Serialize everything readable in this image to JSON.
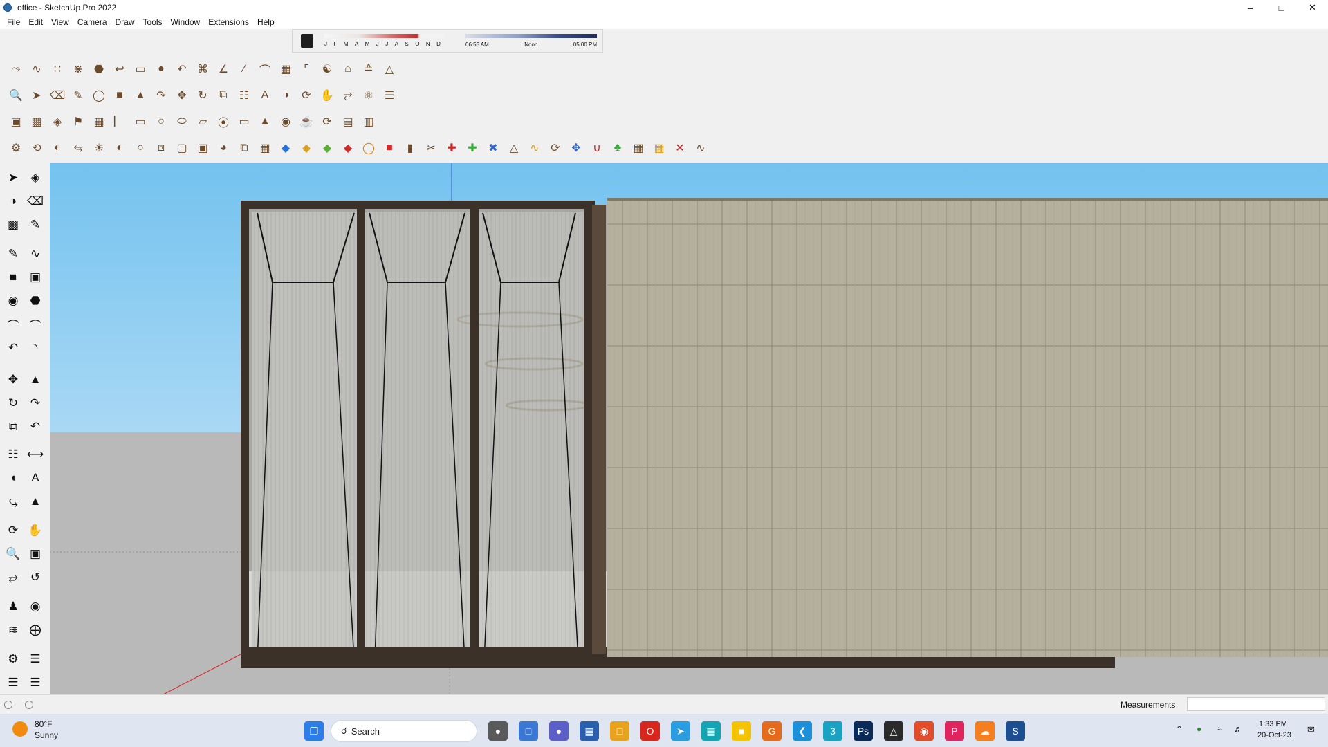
{
  "window": {
    "title": "office - SketchUp Pro 2022",
    "minimize_icon": "minimize-icon",
    "maximize_icon": "maximize-icon",
    "close_icon": "close-icon"
  },
  "menu": [
    "File",
    "Edit",
    "View",
    "Camera",
    "Draw",
    "Tools",
    "Window",
    "Extensions",
    "Help"
  ],
  "shadows": {
    "months": [
      "J",
      "F",
      "M",
      "A",
      "M",
      "J",
      "J",
      "A",
      "S",
      "O",
      "N",
      "D"
    ],
    "time_start": "06:55 AM",
    "time_mid": "Noon",
    "time_end": "05:00 PM"
  },
  "status": {
    "measurements_label": "Measurements",
    "measurements_value": ""
  },
  "taskbar": {
    "weather_temp": "80°F",
    "weather_desc": "Sunny",
    "search_placeholder": "Search",
    "time": "1:33 PM",
    "date": "20-Oct-23"
  },
  "colors": {
    "sky": "#7fc4ec",
    "ground": "#b8b8b8",
    "frame": "#3b3129",
    "stone": "#b7b09e",
    "glass": "#c7c9c8",
    "taskbar": "#dfe6f2"
  }
}
